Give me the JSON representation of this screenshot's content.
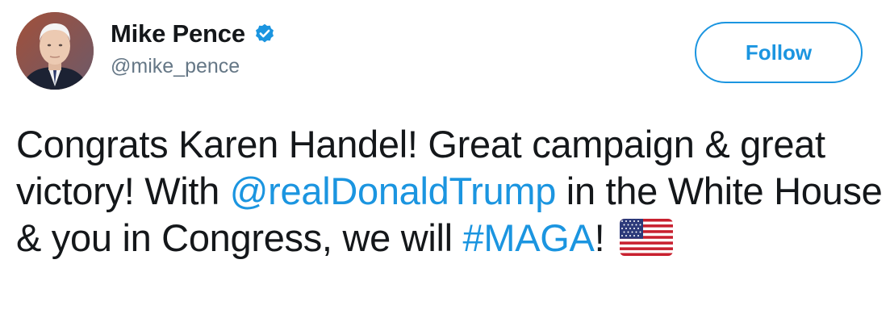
{
  "user": {
    "display_name": "Mike Pence",
    "handle": "@mike_pence",
    "verified_icon": "verified-badge-icon"
  },
  "follow_button": {
    "label": "Follow"
  },
  "tweet": {
    "text_part1": "Congrats Karen Handel! Great campaign & great victory! With ",
    "mention": "@realDonaldTrump",
    "text_part2": " in the White House & you in Congress, we will ",
    "hashtag": "#MAGA",
    "text_part3": "! ",
    "emoji": "us-flag-emoji"
  },
  "colors": {
    "link": "#1b95e0",
    "text": "#14171a",
    "secondary": "#657786"
  }
}
